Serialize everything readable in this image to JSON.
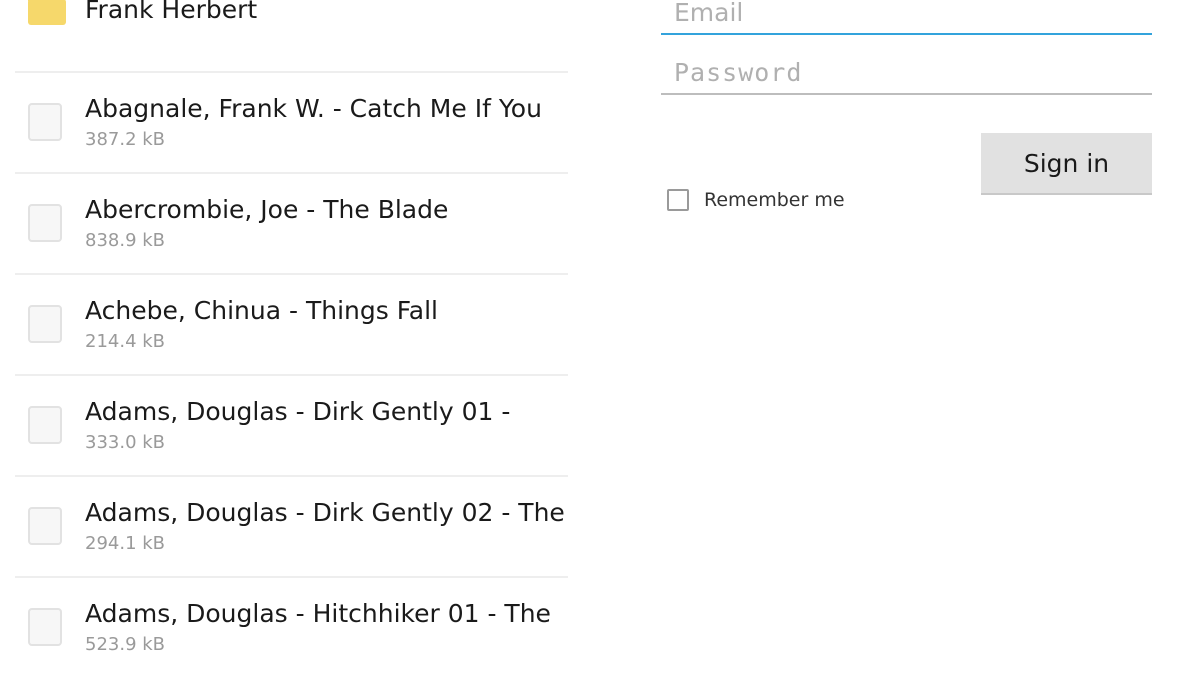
{
  "file_list": {
    "folder": {
      "name": "Frank Herbert",
      "icon": "folder-icon",
      "color": "#f6d86b"
    },
    "files": [
      {
        "title": "Abagnale, Frank W. - Catch Me If You",
        "size": "387.2 kB",
        "icon": "document-icon"
      },
      {
        "title": "Abercrombie, Joe - The Blade",
        "size": "838.9 kB",
        "icon": "document-icon"
      },
      {
        "title": "Achebe, Chinua - Things Fall",
        "size": "214.4 kB",
        "icon": "document-icon"
      },
      {
        "title": "Adams, Douglas - Dirk Gently 01 -",
        "size": "333.0 kB",
        "icon": "document-icon"
      },
      {
        "title": "Adams, Douglas - Dirk Gently 02 - The",
        "size": "294.1 kB",
        "icon": "document-icon"
      },
      {
        "title": "Adams, Douglas - Hitchhiker 01 - The",
        "size": "523.9 kB",
        "icon": "document-icon"
      }
    ]
  },
  "signin_form": {
    "email": {
      "value": "",
      "placeholder": "Email"
    },
    "password": {
      "value": "",
      "placeholder": "Password"
    },
    "submit_label": "Sign in",
    "remember_label": "Remember me",
    "remember_checked": false,
    "accent_color": "#33a3dc"
  }
}
